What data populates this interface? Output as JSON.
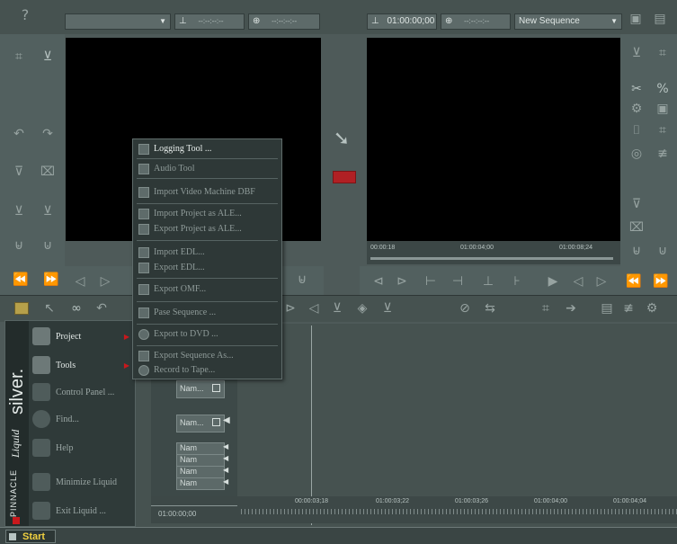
{
  "source_toolbar": {
    "help_glyph": "?",
    "tc_in": "--:--:--:--",
    "tc_out": "--:--:--:--"
  },
  "record_toolbar": {
    "timecode": "01:00:00;00",
    "tc_duration": "--:--:--:--",
    "sequence_select": "New Sequence"
  },
  "record_scrub": {
    "tc_left": "00:00:18",
    "tc_mid": "01:00:04;00",
    "tc_right": "01:00:08;24"
  },
  "context_menu": {
    "items": [
      {
        "label": "Logging Tool ...",
        "enabled": true
      },
      {
        "label": "Audio Tool",
        "enabled": false
      },
      {
        "label": "Import Video Machine DBF",
        "enabled": false
      },
      {
        "label": "Import Project as ALE...",
        "enabled": false
      },
      {
        "label": "Export Project as ALE...",
        "enabled": false
      },
      {
        "label": "Import EDL...",
        "enabled": false
      },
      {
        "label": "Export EDL...",
        "enabled": false
      },
      {
        "label": "Export OMF...",
        "enabled": false
      },
      {
        "label": "Pase Sequence ...",
        "enabled": false
      },
      {
        "label": "Export to DVD ...",
        "enabled": false
      },
      {
        "label": "Export Sequence As...",
        "enabled": false
      },
      {
        "label": "Record to Tape...",
        "enabled": false
      }
    ]
  },
  "start_menu": {
    "brand_text": "silver.",
    "product_text": "Liquid",
    "company_text": "PINNACLE",
    "items": [
      {
        "label": "Project"
      },
      {
        "label": "Tools"
      },
      {
        "label": "Control Panel ..."
      },
      {
        "label": "Find..."
      },
      {
        "label": "Help"
      },
      {
        "label": "Minimize Liquid"
      },
      {
        "label": "Exit Liquid ..."
      }
    ]
  },
  "timeline": {
    "tracks": [
      {
        "label": "Nam..."
      },
      {
        "label": "Nam..."
      },
      {
        "label": "Nam"
      },
      {
        "label": "Nam"
      },
      {
        "label": "Nam"
      },
      {
        "label": "Nam"
      }
    ],
    "timecode": "01:00:00;00",
    "ruler": [
      "00:00:03;18",
      "01:00:03;22",
      "01:00:03;26",
      "01:00:04;00",
      "01:00:04;04"
    ]
  },
  "taskbar": {
    "start_label": "Start"
  },
  "colors": {
    "background": "#4e5a59",
    "monitor": "#000000",
    "accent": "#c8181c",
    "start_text": "#f0d040"
  }
}
